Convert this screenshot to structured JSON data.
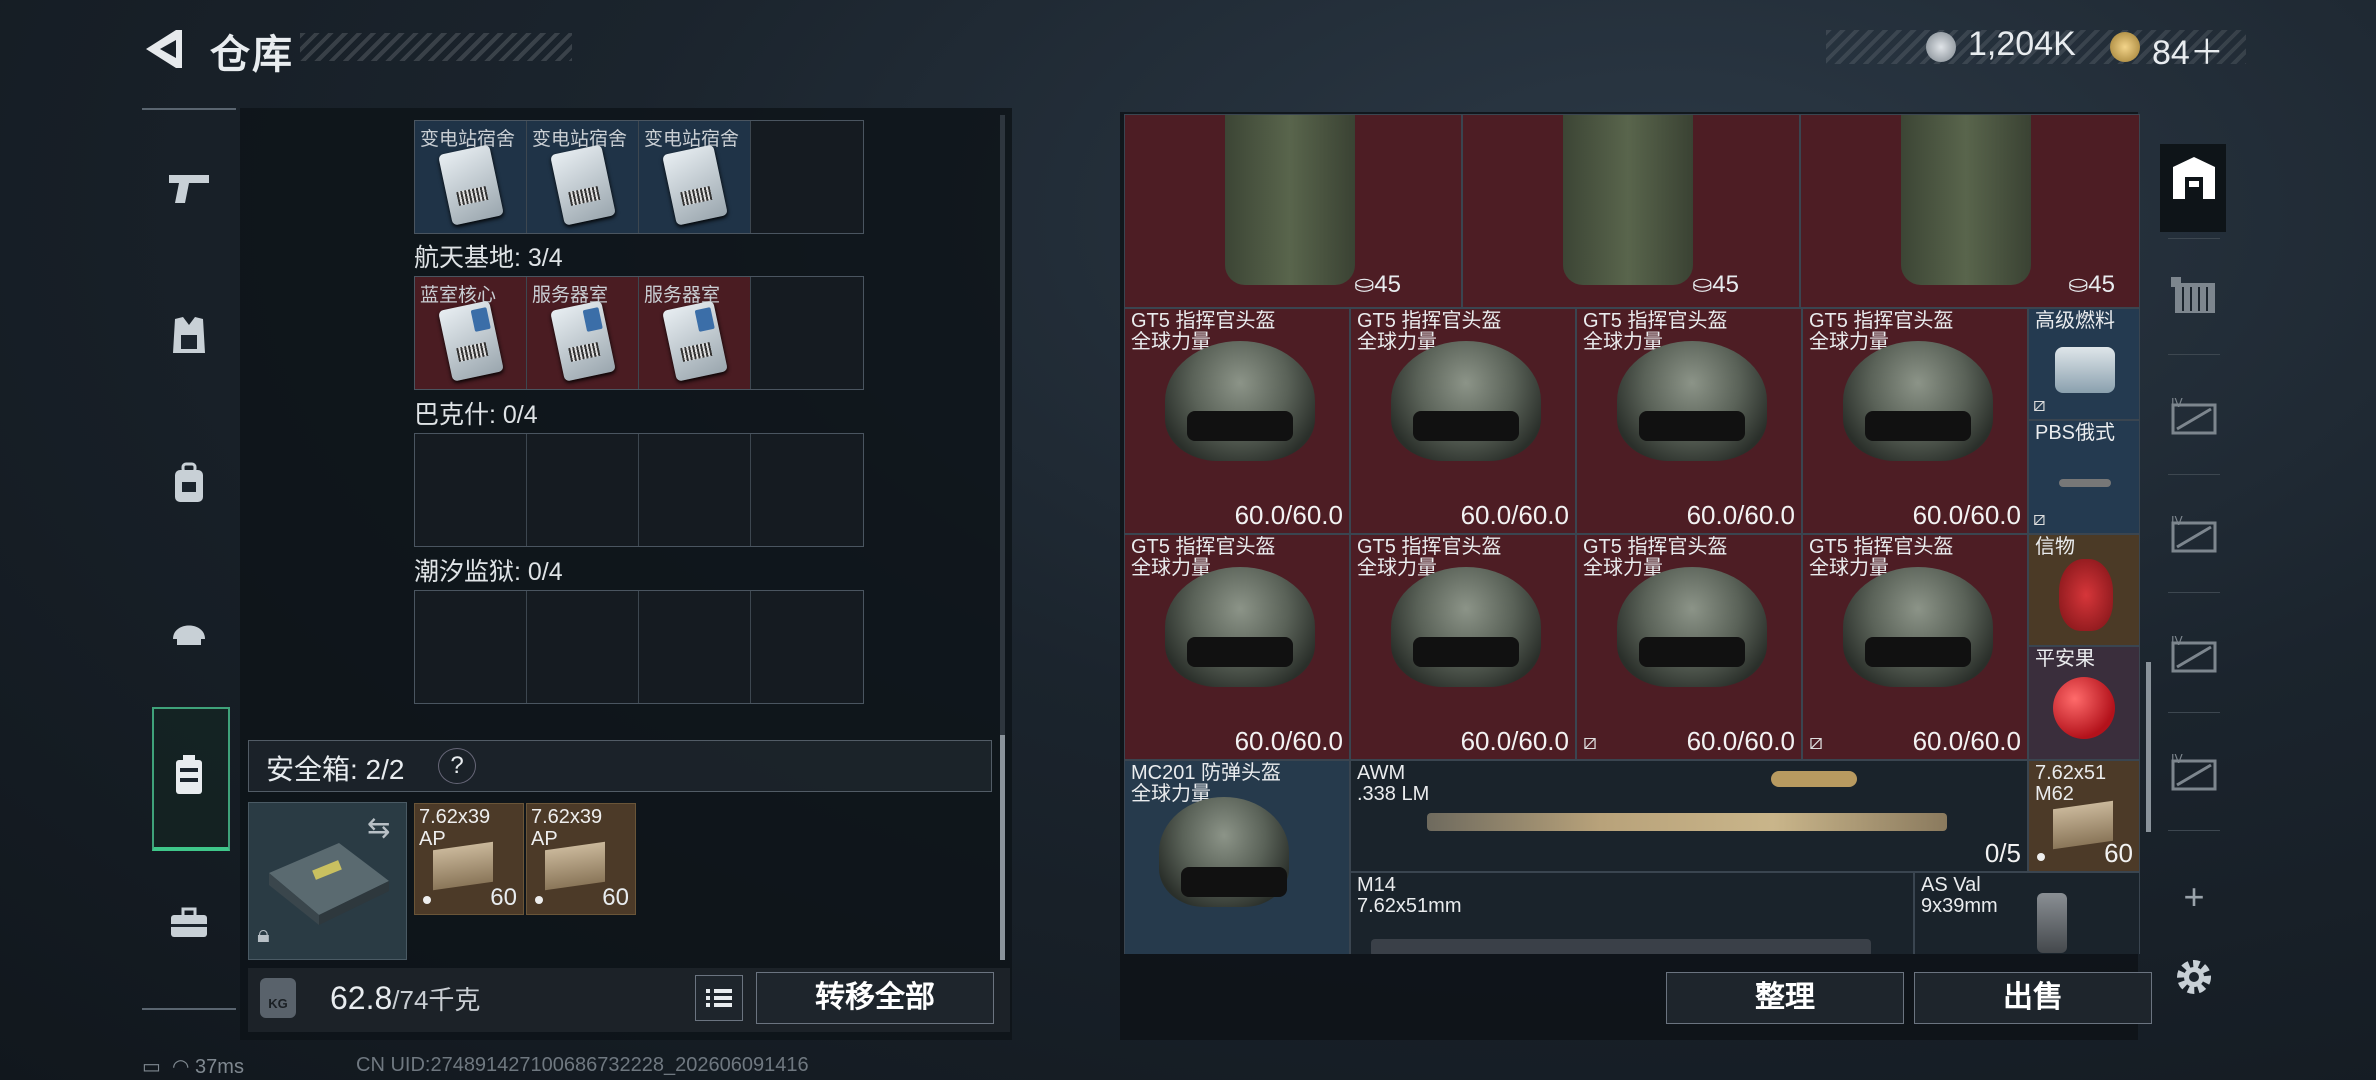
{
  "header": {
    "title": "仓库",
    "back_icon": "back-arrow-icon"
  },
  "currency": {
    "silver": "1,204K",
    "gold": "84＋"
  },
  "left_sidebar": {
    "items": [
      "pistol-icon",
      "vest-icon",
      "backpack-icon",
      "helmet-icon",
      "safebox-icon",
      "briefcase-icon"
    ],
    "active": "safebox-icon"
  },
  "key_sections": [
    {
      "title": "",
      "slots": [
        {
          "label": "变电站宿舍",
          "kind": "key"
        },
        {
          "label": "变电站宿舍",
          "kind": "key"
        },
        {
          "label": "变电站宿舍",
          "kind": "key"
        },
        {
          "label": "",
          "kind": "empty"
        }
      ]
    },
    {
      "title": "航天基地: 3/4",
      "slots": [
        {
          "label": "蓝室核心",
          "kind": "keyblue"
        },
        {
          "label": "服务器室",
          "kind": "keyblue"
        },
        {
          "label": "服务器室",
          "kind": "keyblue"
        },
        {
          "label": "",
          "kind": "empty"
        }
      ]
    },
    {
      "title": "巴克什: 0/4",
      "slots": [
        {
          "label": ""
        },
        {
          "label": ""
        },
        {
          "label": ""
        },
        {
          "label": ""
        }
      ]
    },
    {
      "title": "潮汐监狱: 0/4",
      "slots": [
        {
          "label": ""
        },
        {
          "label": ""
        },
        {
          "label": ""
        },
        {
          "label": ""
        }
      ]
    }
  ],
  "safe_box": {
    "label": "安全箱: 2/2",
    "help": "?",
    "ammo": [
      {
        "name": "7.62x39\nAP",
        "count": "60"
      },
      {
        "name": "7.62x39\nAP",
        "count": "60"
      }
    ]
  },
  "weight": {
    "value": "62.8",
    "max": "/74千克",
    "icon": "KG"
  },
  "actions": {
    "transfer_all": "转移全部",
    "sort": "整理",
    "sell": "出售"
  },
  "storage": {
    "vest_capacity": [
      "45",
      "45",
      "45"
    ],
    "helmet_name": "GT5 指挥官头盔",
    "helmet_sub": "全球力量",
    "helmet_durability": "60.0/60.0",
    "side_items": [
      {
        "name": "高级燃料"
      },
      {
        "name": "PBS俄式"
      },
      {
        "name": "信物"
      },
      {
        "name": "平安果"
      },
      {
        "name": "7.62x51\nM62",
        "count": "60"
      }
    ],
    "mc201": {
      "name": "MC201 防弹头盔",
      "sub": "全球力量"
    },
    "awm": {
      "name": "AWM",
      "sub": ".338 LM",
      "count": "0/5"
    },
    "m14": {
      "name": "M14",
      "sub": "7.62x51mm"
    },
    "asval": {
      "name": "AS Val",
      "sub": "9x39mm"
    }
  },
  "right_sidebar": {
    "items": [
      "home-box-icon",
      "container-icon",
      "crate-iv-icon",
      "crate-iv-icon",
      "crate-iv-icon",
      "crate-iv-icon"
    ],
    "add": "+",
    "settings": "gear-icon"
  },
  "status": {
    "ping": "37ms",
    "uid": "CN UID:274891427100686732228_202606091416"
  }
}
